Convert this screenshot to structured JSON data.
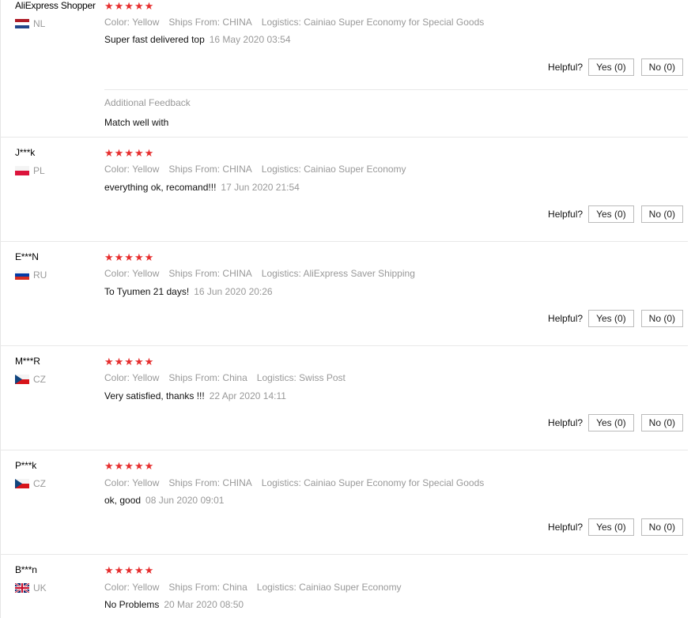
{
  "labels": {
    "color": "Color:",
    "ships_from": "Ships From:",
    "logistics": "Logistics:",
    "helpful": "Helpful?",
    "yes": "Yes (0)",
    "no": "No (0)",
    "additional_feedback": "Additional Feedback"
  },
  "reviews": [
    {
      "user": "AliExpress Shopper",
      "country": "NL",
      "stars": "★★★★★",
      "color": "Yellow",
      "ships_from": "CHINA",
      "logistics": "Cainiao Super Economy for Special Goods",
      "text": "Super fast delivered top",
      "date": "16 May 2020 03:54",
      "additional": "Match well with"
    },
    {
      "user": "J***k",
      "country": "PL",
      "stars": "★★★★★",
      "color": "Yellow",
      "ships_from": "CHINA",
      "logistics": "Cainiao Super Economy",
      "text": "everything ok, recomand!!!",
      "date": "17 Jun 2020 21:54"
    },
    {
      "user": "E***N",
      "country": "RU",
      "stars": "★★★★★",
      "color": "Yellow",
      "ships_from": "CHINA",
      "logistics": "AliExpress Saver Shipping",
      "text": "To Tyumen 21 days!",
      "date": "16 Jun 2020 20:26"
    },
    {
      "user": "M***R",
      "country": "CZ",
      "stars": "★★★★★",
      "color": "Yellow",
      "ships_from": "China",
      "logistics": "Swiss Post",
      "text": "Very satisfied, thanks !!!",
      "date": "22 Apr 2020 14:11"
    },
    {
      "user": "P***k",
      "country": "CZ",
      "stars": "★★★★★",
      "color": "Yellow",
      "ships_from": "CHINA",
      "logistics": "Cainiao Super Economy for Special Goods",
      "text": "ok, good",
      "date": "08 Jun 2020 09:01"
    },
    {
      "user": "B***n",
      "country": "UK",
      "stars": "★★★★★",
      "color": "Yellow",
      "ships_from": "China",
      "logistics": "Cainiao Super Economy",
      "text": "No Problems",
      "date": "20 Mar 2020 08:50"
    }
  ]
}
